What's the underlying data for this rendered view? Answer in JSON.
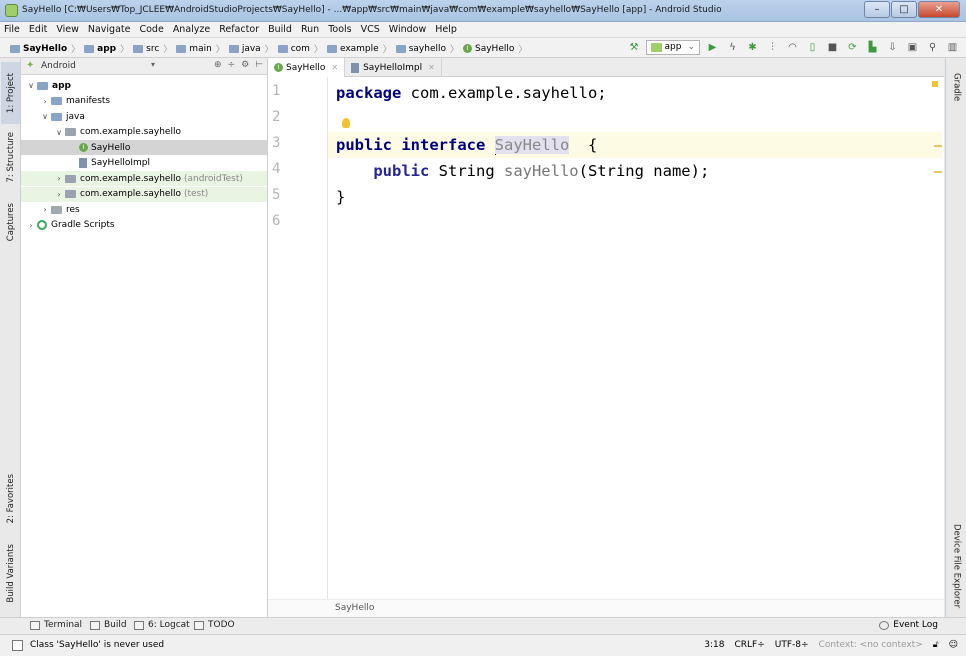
{
  "window": {
    "title": "SayHello [C:₩Users₩Top_JCLEE₩AndroidStudioProjects₩SayHello] - ...₩app₩src₩main₩java₩com₩example₩sayhello₩SayHello [app] - Android Studio",
    "minimize": "–",
    "maximize": "□",
    "close": "✕"
  },
  "menu": [
    "File",
    "Edit",
    "View",
    "Navigate",
    "Code",
    "Analyze",
    "Refactor",
    "Build",
    "Run",
    "Tools",
    "VCS",
    "Window",
    "Help"
  ],
  "breadcrumbs": [
    "SayHello",
    "app",
    "src",
    "main",
    "java",
    "com",
    "example",
    "sayhello",
    "SayHello"
  ],
  "toolbar": {
    "run_config": "app",
    "icons": [
      "hammer-icon",
      "run-icon",
      "debug-icon",
      "profile-icon",
      "coverage-icon",
      "attach-icon",
      "apply-changes-icon",
      "stop-icon",
      "sync-icon",
      "avd-manager-icon",
      "sdk-manager-icon",
      "layout-inspector-icon",
      "search-icon",
      "more-icon"
    ]
  },
  "left_tabs": [
    "1: Project",
    "7: Structure",
    "Captures",
    "2: Favorites",
    "Build Variants"
  ],
  "right_tabs": [
    "Gradle",
    "Device File Explorer"
  ],
  "project_panel": {
    "view": "Android",
    "tree": [
      {
        "label": "app",
        "level": 0,
        "arrow": "∨",
        "icon": "module",
        "bold": true
      },
      {
        "label": "manifests",
        "level": 1,
        "arrow": "›",
        "icon": "folder"
      },
      {
        "label": "java",
        "level": 1,
        "arrow": "∨",
        "icon": "folder"
      },
      {
        "label": "com.example.sayhello",
        "level": 2,
        "arrow": "∨",
        "icon": "package"
      },
      {
        "label": "SayHello",
        "level": 3,
        "arrow": "",
        "icon": "interface",
        "selected": true
      },
      {
        "label": "SayHelloImpl",
        "level": 3,
        "arrow": "",
        "icon": "class"
      },
      {
        "label": "com.example.sayhello",
        "suffix": "(androidTest)",
        "level": 2,
        "arrow": "›",
        "icon": "package",
        "test": true
      },
      {
        "label": "com.example.sayhello",
        "suffix": "(test)",
        "level": 2,
        "arrow": "›",
        "icon": "package",
        "test": true
      },
      {
        "label": "res",
        "level": 1,
        "arrow": "›",
        "icon": "res"
      },
      {
        "label": "Gradle Scripts",
        "level": 0,
        "arrow": "›",
        "icon": "gradle"
      }
    ]
  },
  "editor": {
    "tabs": [
      {
        "label": "SayHello",
        "active": true
      },
      {
        "label": "SayHelloImpl",
        "active": false
      }
    ],
    "line_numbers": [
      "1",
      "2",
      "3",
      "4",
      "5",
      "6"
    ],
    "current_line": 3,
    "lines": {
      "l1_kw": "package",
      "l1_rest": " com.example.sayhello;",
      "l3_kw": "public interface",
      "l3_ident": "SayHello",
      "l3_rest": "  {",
      "l4_kw": "public",
      "l4_type": " String ",
      "l4_method": "sayHello",
      "l4_rest": "(String name);",
      "l5": "}"
    },
    "footer_crumb": "SayHello"
  },
  "bottom_tools": [
    "Terminal",
    "Build",
    "6: Logcat",
    "TODO"
  ],
  "event_log": "Event Log",
  "status": {
    "message": "Class 'SayHello' is never used",
    "position": "3:18",
    "line_sep": "CRLF÷",
    "encoding": "UTF-8÷",
    "context": "Context: <no context>"
  },
  "colors": {
    "keyword": "#000080",
    "selected_row": "#d4d4d4",
    "current_line": "#fdfbe4",
    "run_green": "#3f9a3f"
  }
}
